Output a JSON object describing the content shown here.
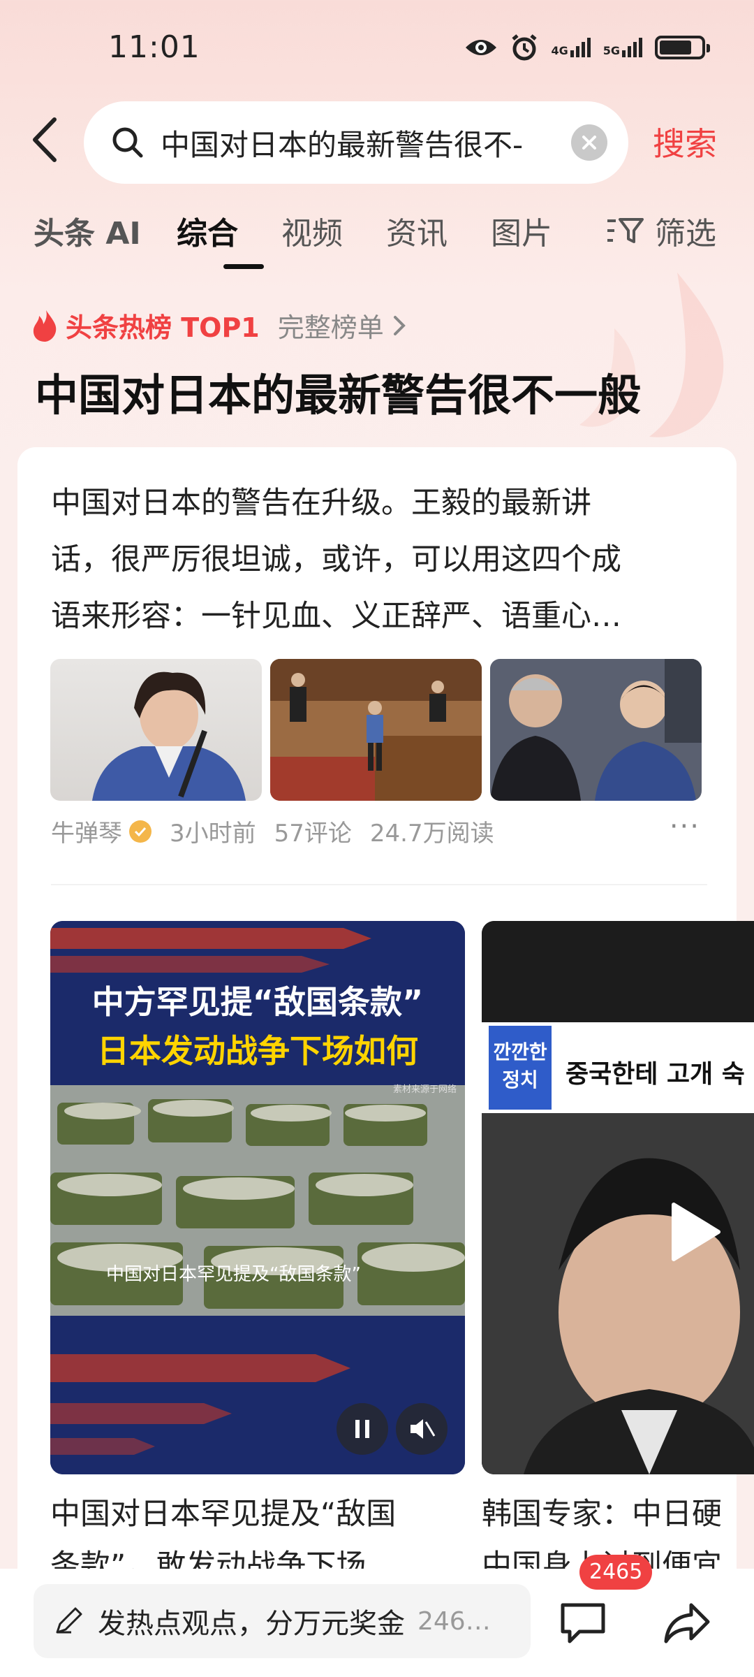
{
  "status_bar": {
    "time": "11:01",
    "net1": "4G",
    "net2": "5G"
  },
  "search": {
    "query": "中国对日本的最新警告很不-",
    "search_button": "搜索"
  },
  "tabs": [
    {
      "label": "头条 AI"
    },
    {
      "label": "综合",
      "active": true
    },
    {
      "label": "视频"
    },
    {
      "label": "资讯"
    },
    {
      "label": "图片"
    },
    {
      "label": "筛选"
    }
  ],
  "hot": {
    "badge": "头条热榜 TOP1",
    "link": "完整榜单",
    "headline": "中国对日本的最新警告很不一般"
  },
  "article": {
    "lines": [
      "中国对日本的警告在升级。王毅的最新讲",
      "话，很严厉很坦诚，或许，可以用这四个成",
      "语来形容：一针见血、义正辞严、语重心…"
    ],
    "author": "牛弹琴",
    "time": "3小时前",
    "comments": "57评论",
    "reads": "24.7万阅读",
    "more": "···"
  },
  "video1": {
    "title_line1": "中方罕见提“敌国条款”",
    "title_line2": "日本发动战争下场如何",
    "caption": "中国对日本罕见提及“敌国条款”",
    "credit": "素材来源于网络",
    "card_title_line1": "中国对日本罕见提及“敌国",
    "card_title_line2": "条款”，敢发动战争下场"
  },
  "video2": {
    "tag": "깐깐한 정치",
    "overlay": "중국한테 고개 숙",
    "card_title_line1": "韩国专家：中日硬",
    "card_title_line2": "中国身上讨到便宜"
  },
  "bottom": {
    "comment_prompt": "发热点观点，分万元奖金",
    "comment_count": "246…",
    "badge": "2465"
  },
  "colors": {
    "accent": "#f04142"
  }
}
